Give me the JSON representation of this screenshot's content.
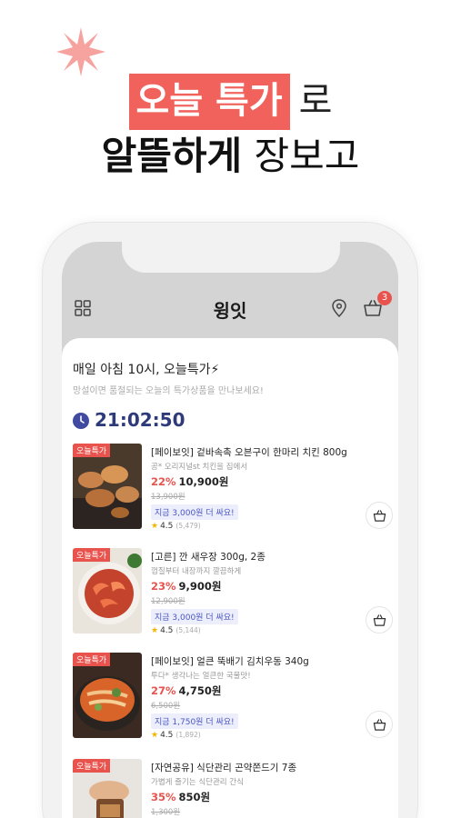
{
  "promo": {
    "line1_highlight": "오늘 특가",
    "line1_tail": "로",
    "line2_bold": "알뜰하게",
    "line2_tail": "장보고"
  },
  "app": {
    "title": "윙잇",
    "cart_count": "3",
    "icons": [
      "grid-icon",
      "location-pin-icon",
      "cart-icon"
    ]
  },
  "section": {
    "title": "매일 아침 10시, 오늘특가⚡",
    "subtitle": "망설이면 품절되는 오늘의 특가상품을 만나보세요!",
    "timer": "21:02:50"
  },
  "products": [
    {
      "tag": "오늘특가",
      "name": "[페이보잇] 겉바속촉 오븐구이 한마리 치킨 800g",
      "desc": "공* 오리지널st 치킨을 집에서",
      "discount": "22%",
      "price": "10,900원",
      "original": "13,900원",
      "save": "지금 3,000원 더 싸요!",
      "rating": "4.5",
      "reviews": "(5,479)"
    },
    {
      "tag": "오늘특가",
      "name": "[고른] 깐 새우장 300g, 2종",
      "desc": "껍질부터 내장까지 깔끔하게",
      "discount": "23%",
      "price": "9,900원",
      "original": "12,900원",
      "save": "지금 3,000원 더 싸요!",
      "rating": "4.5",
      "reviews": "(5,144)"
    },
    {
      "tag": "오늘특가",
      "name": "[페이보잇] 얼큰 뚝배기 김치우동 340g",
      "desc": "투다* 생각나는 얼큰한 국물맛!",
      "discount": "27%",
      "price": "4,750원",
      "original": "6,500원",
      "save": "지금 1,750원 더 싸요!",
      "rating": "4.5",
      "reviews": "(1,892)"
    },
    {
      "tag": "오늘특가",
      "name": "[자연공유] 식단관리 곤약쫀드기 7종",
      "desc": "가볍게 즐기는 식단관리 간식",
      "discount": "35%",
      "price": "850원",
      "original": "1,300원"
    }
  ],
  "colors": {
    "accent": "#e8534d",
    "highlight": "#f0625b",
    "timer": "#2e3a7a",
    "save_text": "#4a57c4"
  }
}
